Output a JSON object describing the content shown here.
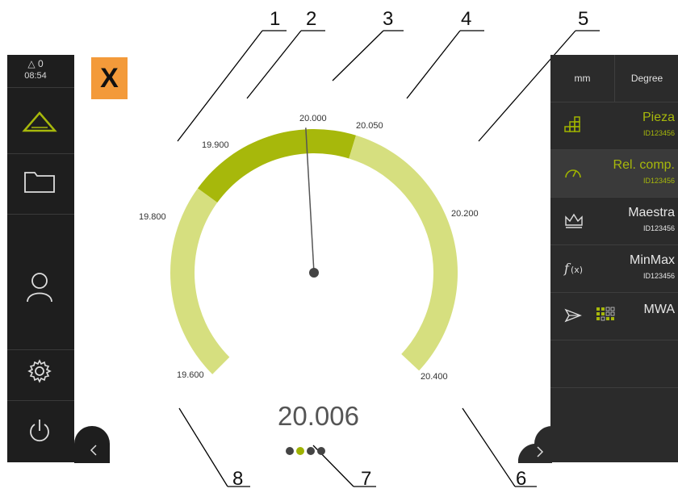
{
  "status": {
    "warnings": "△ 0",
    "time": "08:54"
  },
  "close_button": {
    "label": "X"
  },
  "units": {
    "length": "mm",
    "angle": "Degree"
  },
  "gauge": {
    "value": "20.006",
    "labels": [
      "19.600",
      "19.800",
      "19.900",
      "20.000",
      "20.050",
      "20.200",
      "20.400"
    ],
    "tolerance_range": [
      19.9,
      20.05
    ]
  },
  "callouts": [
    "1",
    "2",
    "3",
    "4",
    "5",
    "6",
    "7",
    "8"
  ],
  "features": [
    {
      "title": "Pieza",
      "id": "ID123456"
    },
    {
      "title": "Rel. comp.",
      "id": "ID123456"
    },
    {
      "title": "Maestra",
      "id": "ID123456"
    },
    {
      "title": "MinMax",
      "id": "ID123456"
    },
    {
      "title": "MWA",
      "id": ""
    }
  ],
  "page_dots": {
    "count": 4,
    "active": 2
  },
  "colors": {
    "accent": "#9fb300",
    "gauge_light": "#d6df7f",
    "gauge_dark": "#a7b80b",
    "close": "#f39a3a"
  }
}
